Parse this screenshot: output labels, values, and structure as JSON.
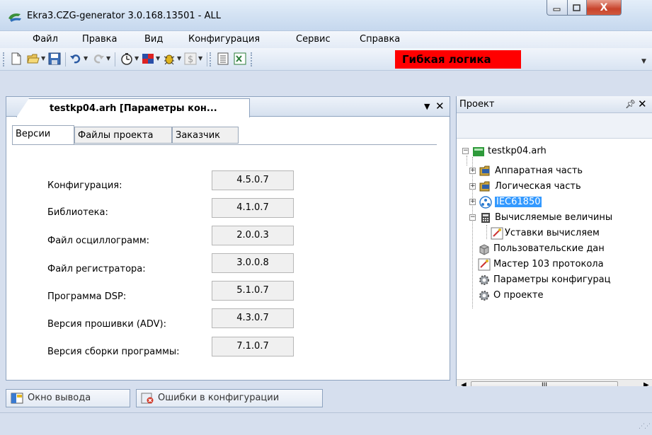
{
  "window": {
    "title": "Ekra3.CZG-generator 3.0.168.13501 - ALL",
    "controls": {
      "minimize": "–",
      "maximize": "□",
      "close": "X"
    }
  },
  "menu": [
    "Файл",
    "Правка",
    "Вид",
    "Конфигурация",
    "Сервис",
    "Справка"
  ],
  "toolbar": {
    "flex_logic_label": "Гибкая логика"
  },
  "document": {
    "tab_title": "testkp04.arh [Параметры кон...",
    "inner_tabs": [
      "Версии",
      "Файлы проекта",
      "Заказчик"
    ],
    "versions": [
      {
        "label": "Конфигурация:",
        "value": "4.5.0.7"
      },
      {
        "label": "Библиотека:",
        "value": "4.1.0.7"
      },
      {
        "label": "Файл осциллограмм:",
        "value": "2.0.0.3"
      },
      {
        "label": "Файл регистратора:",
        "value": "3.0.0.8"
      },
      {
        "label": "Программа DSP:",
        "value": "5.1.0.7"
      },
      {
        "label": "Версия прошивки (ADV):",
        "value": "4.3.0.7"
      },
      {
        "label": "Версия сборки программы:",
        "value": "7.1.0.7"
      }
    ]
  },
  "project": {
    "title": "Проект",
    "tree": {
      "root": "testkp04.arh",
      "items": [
        "Аппаратная часть",
        "Логическая часть",
        "IEC61850",
        "Вычисляемые величины",
        "Уставки вычисляем",
        "Пользовательские дан",
        "Мастер 103 протокола",
        "Параметры конфигурац",
        "О проекте"
      ]
    },
    "scroll_thumb": "III"
  },
  "bottom_tabs": [
    "Окно вывода",
    "Ошибки в конфигурации"
  ]
}
